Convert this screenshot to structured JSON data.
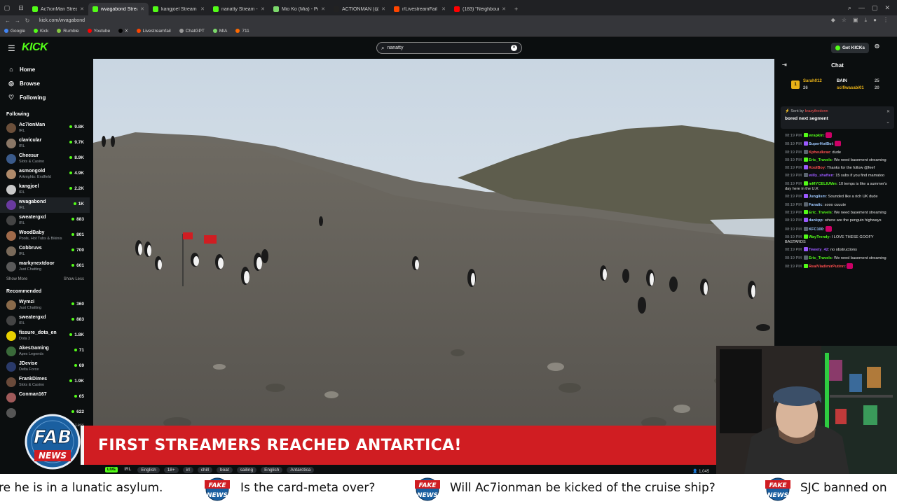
{
  "browser": {
    "tabs": [
      {
        "label": "Ac7ionMan Stream - V",
        "color": "#53fc18"
      },
      {
        "label": "wvagabond Stream -",
        "color": "#53fc18",
        "active": true
      },
      {
        "label": "kangjoel Stream - Wa",
        "color": "#53fc18"
      },
      {
        "label": "nanatty Stream - Watc",
        "color": "#53fc18"
      },
      {
        "label": "Mio Ko (Mia) - Pump",
        "color": "#7cd96b"
      },
      {
        "label": "ACTIONMAN (@Ac7ionM",
        "color": "#222"
      },
      {
        "label": "r/LivestreamFail",
        "color": "#ff4500"
      },
      {
        "label": "(183) \"Neighbour Love a V",
        "color": "#ff0000"
      }
    ],
    "url": "kick.com/wvagabond",
    "bookmarks": [
      {
        "label": "Google",
        "color": "#4285f4"
      },
      {
        "label": "Kick",
        "color": "#53fc18"
      },
      {
        "label": "Rumble",
        "color": "#85c742"
      },
      {
        "label": "Youtube",
        "color": "#ff0000"
      },
      {
        "label": "X",
        "color": "#000"
      },
      {
        "label": "Livestreamfail",
        "color": "#ff4500"
      },
      {
        "label": "ChatGPT",
        "color": "#999"
      },
      {
        "label": "MIA",
        "color": "#7cd96b"
      },
      {
        "label": "711",
        "color": "#ff6a00"
      }
    ]
  },
  "header": {
    "logo": "KICK",
    "search_value": "nanatty",
    "get_kicks": "Get KICKs"
  },
  "sidebar": {
    "nav": [
      {
        "label": "Home",
        "icon": "home-icon",
        "glyph": "⌂"
      },
      {
        "label": "Browse",
        "icon": "browse-icon",
        "glyph": "◎"
      },
      {
        "label": "Following",
        "icon": "heart-icon",
        "glyph": "♡"
      }
    ],
    "following_title": "Following",
    "following": [
      {
        "name": "Ac7ionMan",
        "cat": "IRL",
        "viewers": "9.8K",
        "color": "#6b4f3a"
      },
      {
        "name": "clavicular",
        "cat": "IRL",
        "viewers": "9.7K",
        "color": "#8a7766"
      },
      {
        "name": "Cheesur",
        "cat": "Slots & Casino",
        "viewers": "8.9K",
        "color": "#3a5a8a"
      },
      {
        "name": "asmongold",
        "cat": "Arknights: Endfield",
        "viewers": "4.9K",
        "color": "#b08a6a"
      },
      {
        "name": "kangjoel",
        "cat": "IRL",
        "viewers": "2.2K",
        "color": "#c9c9c9"
      },
      {
        "name": "wvagabond",
        "cat": "IRL",
        "viewers": "1K",
        "color": "#6a3aa0",
        "active": true
      },
      {
        "name": "sweatergxd",
        "cat": "IRL",
        "viewers": "883",
        "color": "#444"
      },
      {
        "name": "WoodBaby",
        "cat": "Pools, Hot Tubs & Bikinis",
        "viewers": "801",
        "color": "#a06a4a"
      },
      {
        "name": "Cobbruvs",
        "cat": "IRL",
        "viewers": "700",
        "color": "#7a6a5a"
      },
      {
        "name": "markynextdoor",
        "cat": "Just Chatting",
        "viewers": "601",
        "color": "#5a5a5a"
      }
    ],
    "show_more": "Show More",
    "show_less": "Show Less",
    "recommended_title": "Recommended",
    "recommended": [
      {
        "name": "Wymzi",
        "cat": "Just Chatting",
        "viewers": "360",
        "color": "#8a6a4a"
      },
      {
        "name": "sweatergxd",
        "cat": "IRL",
        "viewers": "883",
        "color": "#444"
      },
      {
        "name": "fissure_dota_en",
        "cat": "Dota 2",
        "viewers": "1.8K",
        "color": "#e8d000"
      },
      {
        "name": "AkesGaming",
        "cat": "Apex Legends",
        "viewers": "71",
        "color": "#3a6a3a"
      },
      {
        "name": "JDevise",
        "cat": "Delta Force",
        "viewers": "69",
        "color": "#2a3a6a"
      },
      {
        "name": "FrankDimes",
        "cat": "Slots & Casino",
        "viewers": "1.9K",
        "color": "#6a4a3a"
      },
      {
        "name": "Conman167",
        "cat": "",
        "viewers": "65",
        "color": "#a05a5a"
      },
      {
        "name": "",
        "cat": "",
        "viewers": "622",
        "color": "#555"
      }
    ],
    "show_less_bottom": "Show Less"
  },
  "stream": {
    "live": "LIVE",
    "tags": [
      "IRL",
      "English",
      "18+",
      "irl",
      "chill",
      "boat",
      "sailing",
      "English",
      "Antarctica"
    ],
    "viewers": "1,045"
  },
  "chat": {
    "title": "Chat",
    "leaderboard": [
      {
        "name": "Sarah012",
        "value": "26",
        "color": "#e8b117"
      },
      {
        "name": "BAIN",
        "value": "25",
        "color": "#ffffff"
      },
      {
        "name": "scifiwasabi01",
        "value": "20",
        "color": "#e8b117"
      }
    ],
    "pinned_by_label": "Sent by",
    "pinned_by": "krazythedonn",
    "pinned_msg": "bored next segment",
    "messages": [
      {
        "time": "08:19 PM",
        "user": "wrapkin",
        "text": "",
        "color": "#53fc18"
      },
      {
        "time": "08:19 PM",
        "user": "SuperHotBoi",
        "text": "",
        "color": "#9ec8ff"
      },
      {
        "time": "08:19 PM",
        "user": "Kpheulkrax",
        "text": "dude",
        "color": "#ff4f4f"
      },
      {
        "time": "08:19 PM",
        "user": "Eric_Travels",
        "text": "We need basement streaming",
        "color": "#53fc18"
      },
      {
        "time": "08:19 PM",
        "user": "KoolBoy",
        "text": "Thanks for the follow @feef",
        "color": "#ff4f4f"
      },
      {
        "time": "08:19 PM",
        "user": "willy_shaften",
        "text": "15 subs if you find mamatoo",
        "color": "#9b59ff"
      },
      {
        "time": "08:19 PM",
        "user": "mMYCELIUMm",
        "text": "10 temps is like a summer's day here in the U.K",
        "color": "#53fc18"
      },
      {
        "time": "08:19 PM",
        "user": "Junglism",
        "text": "Sounded like a rich UK dude",
        "color": "#9ec8ff"
      },
      {
        "time": "08:19 PM",
        "user": "Fanatic",
        "text": "sooo cuuute",
        "color": "#9ec8ff"
      },
      {
        "time": "08:19 PM",
        "user": "Eric_Travels",
        "text": "We need basement streaming",
        "color": "#53fc18"
      },
      {
        "time": "08:19 PM",
        "user": "dankpp",
        "text": "where are the penguin highways",
        "color": "#9ec8ff"
      },
      {
        "time": "08:19 PM",
        "user": "KFC100",
        "text": "",
        "color": "#9ec8ff"
      },
      {
        "time": "08:19 PM",
        "user": "WayTrendy",
        "text": "I LOVE THESE GOOFY BASTARDS",
        "color": "#53fc18"
      },
      {
        "time": "08:19 PM",
        "user": "Tweety_42",
        "text": "no obstructions",
        "color": "#9b59ff"
      },
      {
        "time": "08:19 PM",
        "user": "Eric_Travels",
        "text": "We need basement streaming",
        "color": "#53fc18"
      },
      {
        "time": "08:19 PM",
        "user": "RealVladimirPutinn",
        "text": "",
        "color": "#ff4f4f"
      }
    ]
  },
  "overlay": {
    "headline": "FIRST STREAMERS REACHED ANTARTICA!",
    "logo_text": "FAB",
    "logo_sub": "NEWS",
    "fake_top": "FAKE",
    "fake_bottom": "NEWS",
    "ticker": [
      "re he is in a lunatic asylum.",
      "Is the card-meta over?",
      "Will Ac7ionman be kicked of the cruise ship?",
      "SJC banned on"
    ]
  },
  "colors": {
    "accent": "#53fc18",
    "banner": "#d01d22"
  }
}
